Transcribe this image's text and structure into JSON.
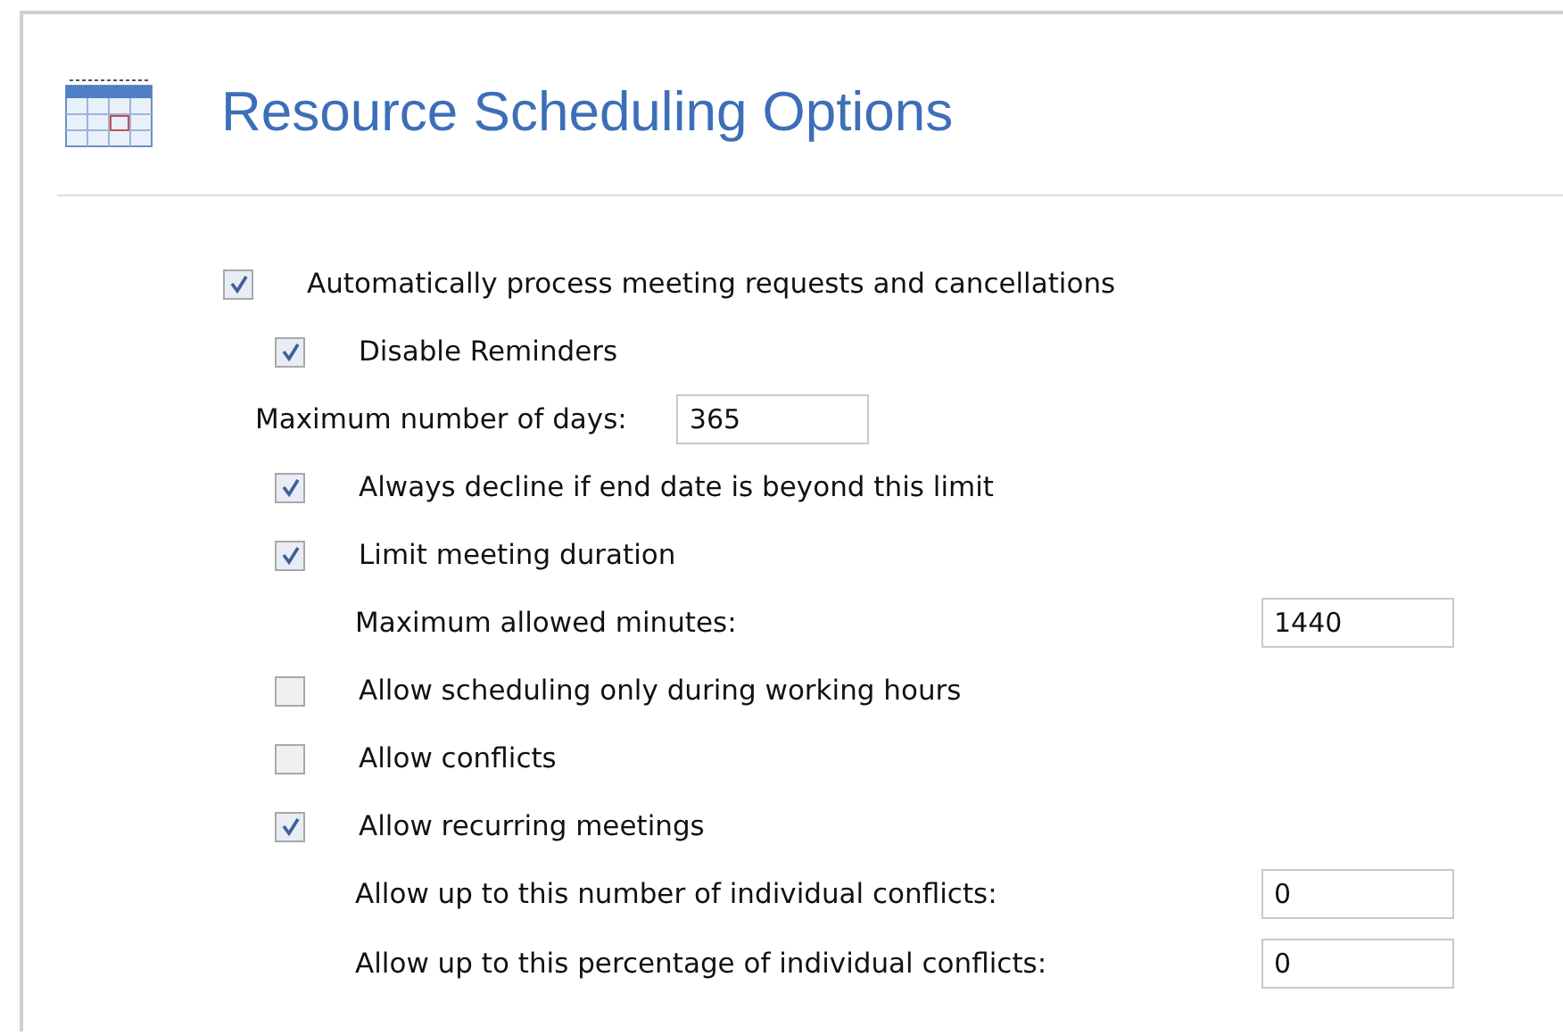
{
  "header": {
    "title": "Resource Scheduling Options"
  },
  "options": [
    {
      "kind": "checkbox",
      "label": "Automatically process meeting requests and cancellations",
      "checked": true,
      "children": [
        {
          "kind": "checkbox",
          "label": "Disable Reminders",
          "checked": true
        },
        {
          "kind": "field",
          "label": "Maximum number of days:",
          "value": "365"
        },
        {
          "kind": "checkbox",
          "label": "Always decline if end date is beyond this limit",
          "checked": true
        },
        {
          "kind": "checkbox",
          "label": "Limit meeting duration",
          "checked": true,
          "children": [
            {
              "kind": "field",
              "label": "Maximum allowed minutes:",
              "value": "1440"
            }
          ]
        },
        {
          "kind": "checkbox",
          "label": "Allow scheduling only during working hours",
          "checked": false
        },
        {
          "kind": "checkbox",
          "label": "Allow conflicts",
          "checked": false
        },
        {
          "kind": "checkbox",
          "label": "Allow recurring meetings",
          "checked": true,
          "children": [
            {
              "kind": "field",
              "label": "Allow up to this number of individual conflicts:",
              "value": "0"
            },
            {
              "kind": "field",
              "label": "Allow up to this percentage of individual conflicts:",
              "value": "0"
            }
          ]
        }
      ]
    }
  ]
}
